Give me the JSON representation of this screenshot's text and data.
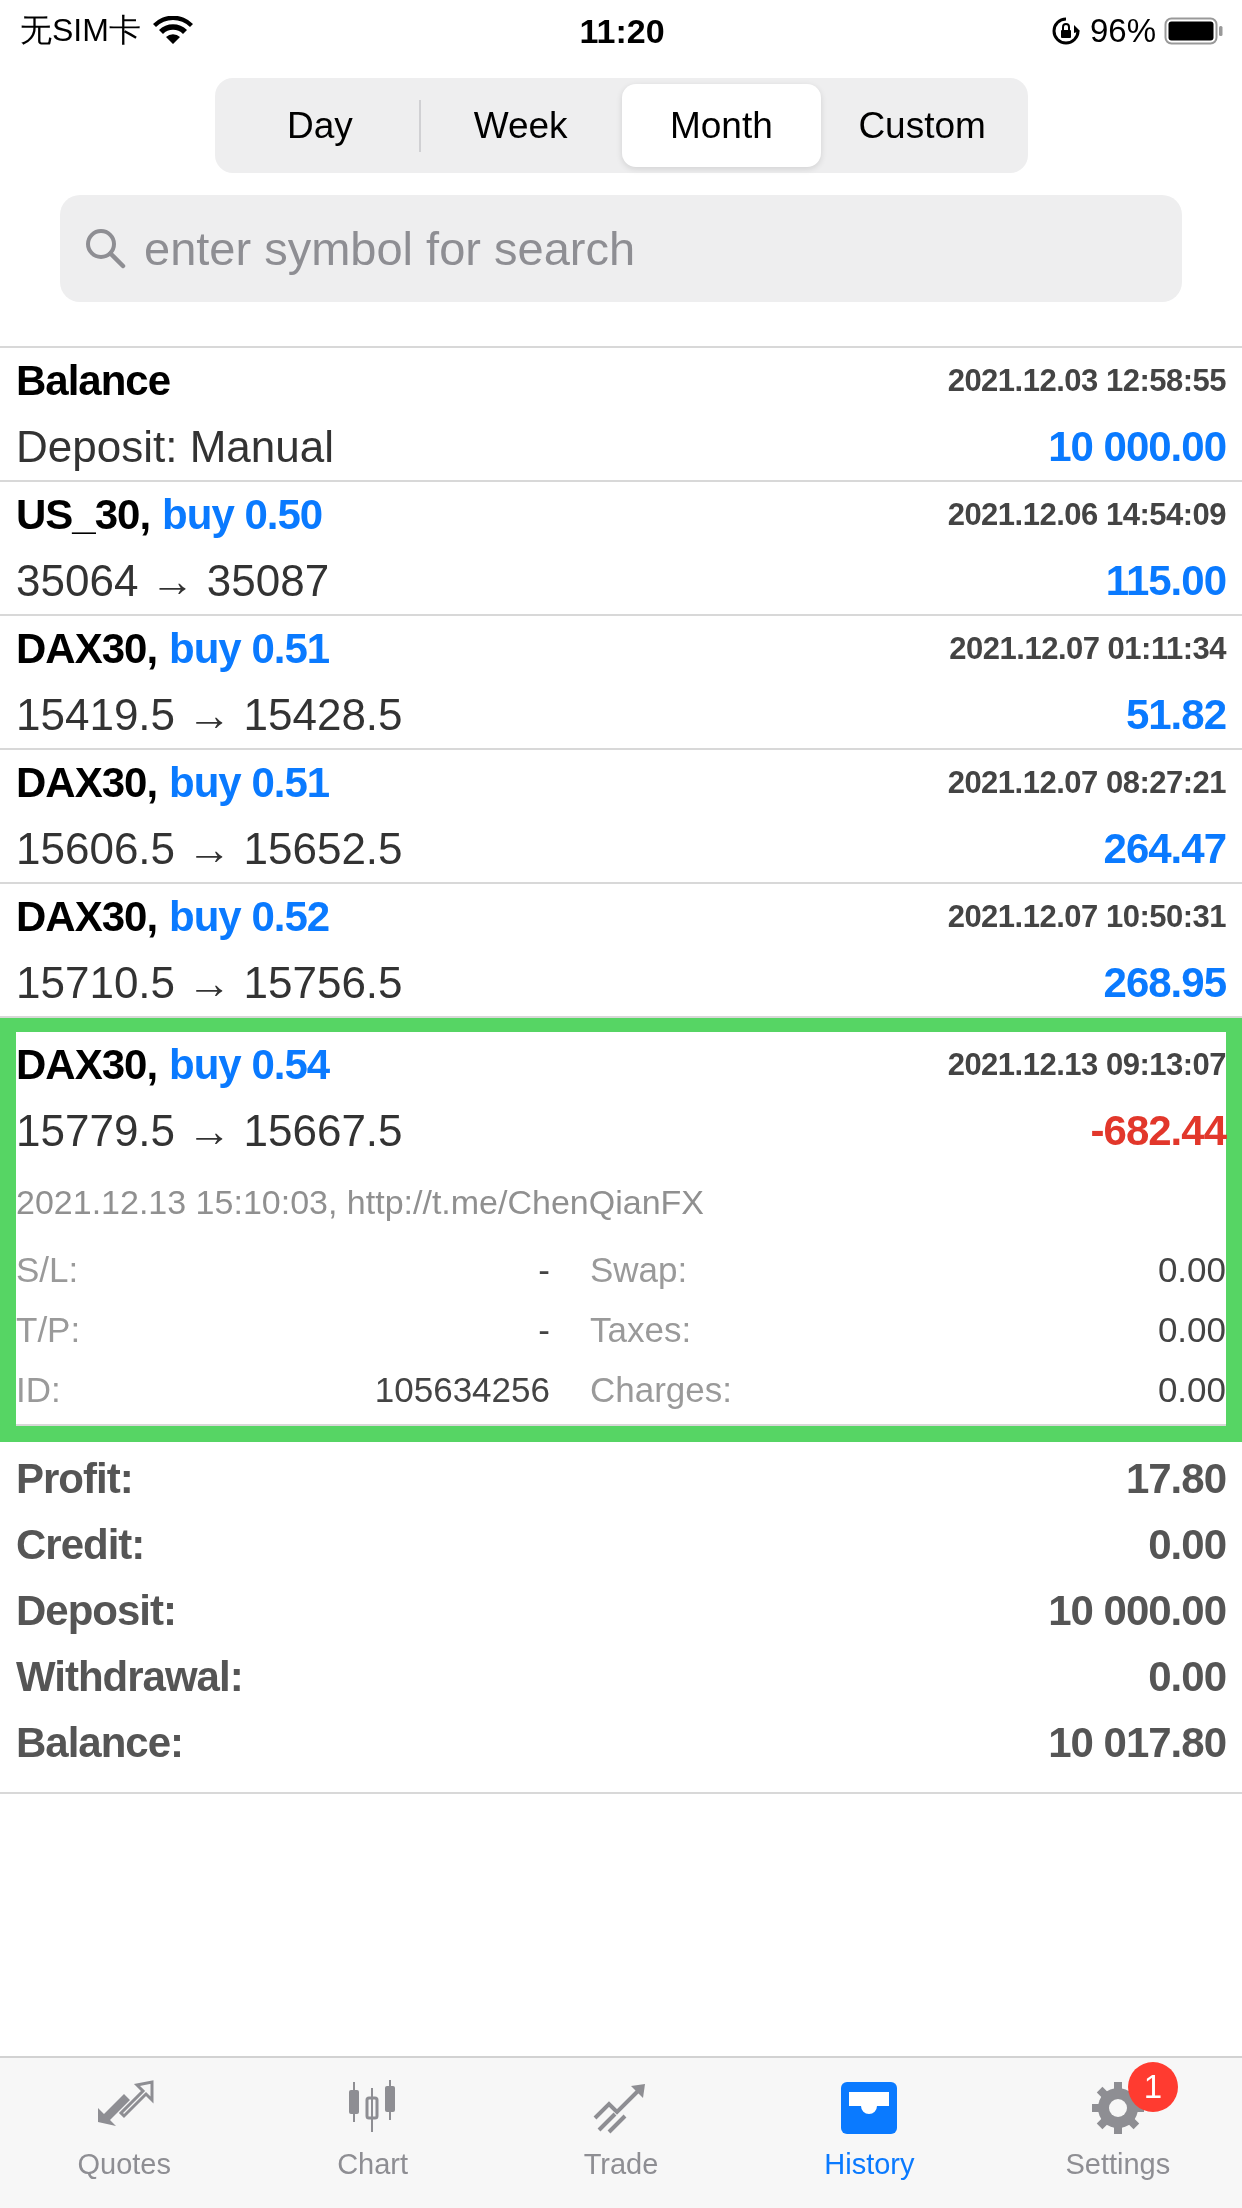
{
  "status_bar": {
    "carrier": "无SIM卡",
    "time": "11:20",
    "battery": "96%"
  },
  "segments": [
    {
      "label": "Day",
      "selected": false
    },
    {
      "label": "Week",
      "selected": false
    },
    {
      "label": "Month",
      "selected": true
    },
    {
      "label": "Custom",
      "selected": false
    }
  ],
  "search": {
    "placeholder": "enter symbol for search"
  },
  "deals": [
    {
      "kind": "balance",
      "title": "Balance",
      "time": "2021.12.03 12:58:55",
      "detail": "Deposit: Manual",
      "amount": "10 000.00",
      "negative": false,
      "expanded": false,
      "highlighted": false
    },
    {
      "kind": "trade",
      "symbol": "US_30,",
      "action": "buy 0.50",
      "time": "2021.12.06 14:54:09",
      "prices": "35064 → 35087",
      "amount": "115.00",
      "negative": false,
      "expanded": false,
      "highlighted": false
    },
    {
      "kind": "trade",
      "symbol": "DAX30,",
      "action": "buy 0.51",
      "time": "2021.12.07 01:11:34",
      "prices": "15419.5 → 15428.5",
      "amount": "51.82",
      "negative": false,
      "expanded": false,
      "highlighted": false
    },
    {
      "kind": "trade",
      "symbol": "DAX30,",
      "action": "buy 0.51",
      "time": "2021.12.07 08:27:21",
      "prices": "15606.5 → 15652.5",
      "amount": "264.47",
      "negative": false,
      "expanded": false,
      "highlighted": false
    },
    {
      "kind": "trade",
      "symbol": "DAX30,",
      "action": "buy 0.52",
      "time": "2021.12.07 10:50:31",
      "prices": "15710.5 → 15756.5",
      "amount": "268.95",
      "negative": false,
      "expanded": false,
      "highlighted": false
    },
    {
      "kind": "trade",
      "symbol": "DAX30,",
      "action": "buy 0.54",
      "time": "2021.12.13 09:13:07",
      "prices": "15779.5 → 15667.5",
      "amount": "-682.44",
      "negative": true,
      "expanded": true,
      "highlighted": true,
      "comment": "2021.12.13 15:10:03, http://t.me/ChenQianFX",
      "fields": [
        {
          "label": "S/L:",
          "value": "-"
        },
        {
          "label": "Swap:",
          "value": "0.00"
        },
        {
          "label": "T/P:",
          "value": "-"
        },
        {
          "label": "Taxes:",
          "value": "0.00"
        },
        {
          "label": "ID:",
          "value": "105634256"
        },
        {
          "label": "Charges:",
          "value": "0.00"
        }
      ]
    }
  ],
  "summary": [
    {
      "label": "Profit:",
      "value": "17.80"
    },
    {
      "label": "Credit:",
      "value": "0.00"
    },
    {
      "label": "Deposit:",
      "value": "10 000.00"
    },
    {
      "label": "Withdrawal:",
      "value": "0.00"
    },
    {
      "label": "Balance:",
      "value": "10 017.80"
    }
  ],
  "tab_bar": [
    {
      "kind": "quotes",
      "label": "Quotes",
      "selected": false
    },
    {
      "kind": "chart",
      "label": "Chart",
      "selected": false
    },
    {
      "kind": "trade",
      "label": "Trade",
      "selected": false
    },
    {
      "kind": "history",
      "label": "History",
      "selected": true
    },
    {
      "kind": "settings",
      "label": "Settings",
      "selected": false,
      "badge": "1"
    }
  ]
}
